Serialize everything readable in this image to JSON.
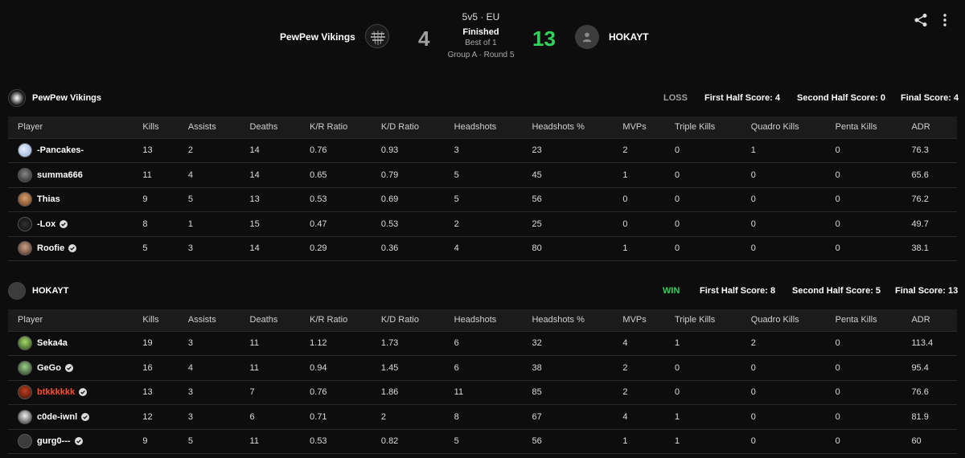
{
  "match": {
    "mode": "5v5 · EU",
    "status": "Finished",
    "best_of": "Best of 1",
    "round": "Group A · Round 5",
    "team_left": {
      "name": "PewPew Vikings",
      "score": "4"
    },
    "team_right": {
      "name": "HOKAYT",
      "score": "13"
    }
  },
  "icons": {
    "share": "share-icon",
    "more": "more-vert-icon",
    "verified": "verified-check-icon"
  },
  "colors": {
    "win": "#32d35a",
    "loss": "#a0a0a0",
    "highlight_player": "#ff5030"
  },
  "columns": [
    "Player",
    "Kills",
    "Assists",
    "Deaths",
    "K/R Ratio",
    "K/D Ratio",
    "Headshots",
    "Headshots %",
    "MVPs",
    "Triple Kills",
    "Quadro Kills",
    "Penta Kills",
    "ADR"
  ],
  "teams": [
    {
      "name": "PewPew Vikings",
      "result": "LOSS",
      "first_half": "First Half Score: 4",
      "second_half": "Second Half Score: 0",
      "final": "Final Score: 4",
      "players": [
        {
          "name": "-Pancakes-",
          "verified": false,
          "stats": [
            "13",
            "2",
            "14",
            "0.76",
            "0.93",
            "3",
            "23",
            "2",
            "0",
            "1",
            "0",
            "76.3"
          ]
        },
        {
          "name": "summa666",
          "verified": false,
          "stats": [
            "11",
            "4",
            "14",
            "0.65",
            "0.79",
            "5",
            "45",
            "1",
            "0",
            "0",
            "0",
            "65.6"
          ]
        },
        {
          "name": "Thias",
          "verified": false,
          "stats": [
            "9",
            "5",
            "13",
            "0.53",
            "0.69",
            "5",
            "56",
            "0",
            "0",
            "0",
            "0",
            "76.2"
          ]
        },
        {
          "name": "-Lox",
          "verified": true,
          "stats": [
            "8",
            "1",
            "15",
            "0.47",
            "0.53",
            "2",
            "25",
            "0",
            "0",
            "0",
            "0",
            "49.7"
          ]
        },
        {
          "name": "Roofie",
          "verified": true,
          "stats": [
            "5",
            "3",
            "14",
            "0.29",
            "0.36",
            "4",
            "80",
            "1",
            "0",
            "0",
            "0",
            "38.1"
          ]
        }
      ]
    },
    {
      "name": "HOKAYT",
      "result": "WIN",
      "first_half": "First Half Score: 8",
      "second_half": "Second Half Score: 5",
      "final": "Final Score: 13",
      "players": [
        {
          "name": "Seka4a",
          "verified": false,
          "stats": [
            "19",
            "3",
            "11",
            "1.12",
            "1.73",
            "6",
            "32",
            "4",
            "1",
            "2",
            "0",
            "113.4"
          ]
        },
        {
          "name": "GeGo",
          "verified": true,
          "stats": [
            "16",
            "4",
            "11",
            "0.94",
            "1.45",
            "6",
            "38",
            "2",
            "0",
            "0",
            "0",
            "95.4"
          ]
        },
        {
          "name": "btkkkkkk",
          "verified": true,
          "highlight": true,
          "stats": [
            "13",
            "3",
            "7",
            "0.76",
            "1.86",
            "11",
            "85",
            "2",
            "0",
            "0",
            "0",
            "76.6"
          ]
        },
        {
          "name": "c0de-iwnl",
          "verified": true,
          "stats": [
            "12",
            "3",
            "6",
            "0.71",
            "2",
            "8",
            "67",
            "4",
            "1",
            "0",
            "0",
            "81.9"
          ]
        },
        {
          "name": "gurg0---",
          "verified": true,
          "stats": [
            "9",
            "5",
            "11",
            "0.53",
            "0.82",
            "5",
            "56",
            "1",
            "1",
            "0",
            "0",
            "60"
          ]
        }
      ]
    }
  ]
}
